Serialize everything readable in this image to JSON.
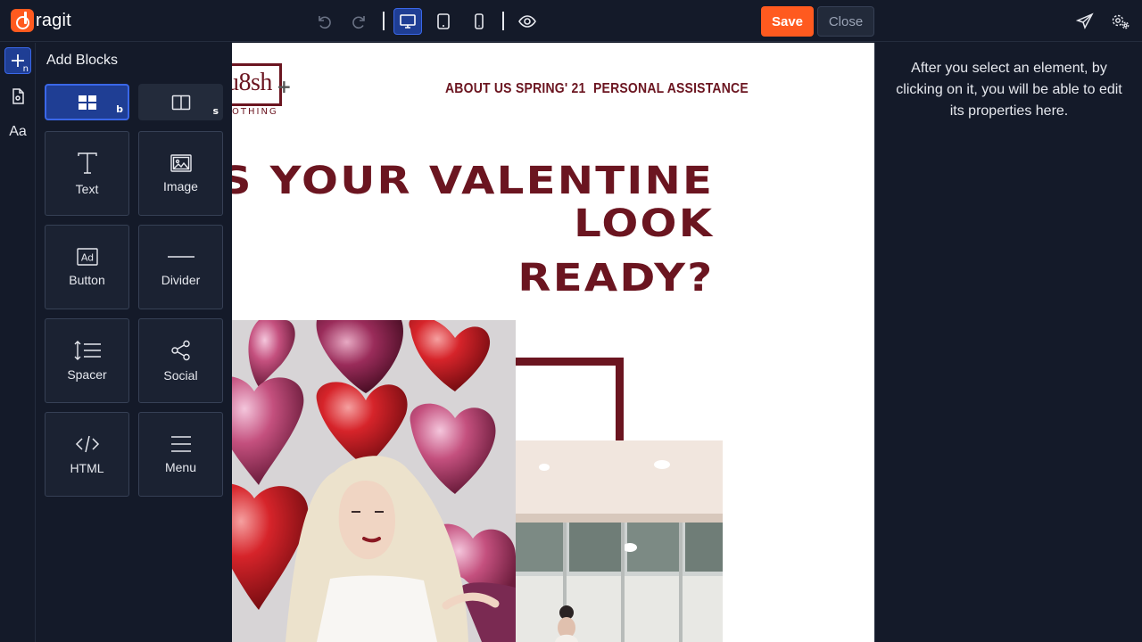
{
  "app": {
    "name": "ragit"
  },
  "toolbar": {
    "save_label": "Save",
    "close_label": "Close",
    "icons": [
      "undo-icon",
      "redo-icon",
      "desktop-icon",
      "tablet-icon",
      "mobile-icon",
      "eye-icon",
      "send-icon",
      "settings-icon"
    ],
    "accent": "#ff5a1f",
    "active": "#1f3e94"
  },
  "rail": {
    "add_key": "n",
    "typography_label": "Aa"
  },
  "panel": {
    "title": "Add Blocks",
    "tabs": [
      {
        "key": "b",
        "icon": "grid-icon"
      },
      {
        "key": "s",
        "icon": "columns-icon"
      }
    ],
    "blocks": [
      {
        "label": "Text",
        "icon": "text-icon"
      },
      {
        "label": "Image",
        "icon": "image-icon"
      },
      {
        "label": "Button",
        "icon": "ad-icon",
        "icon_text": "Ad"
      },
      {
        "label": "Divider",
        "icon": "divider-icon"
      },
      {
        "label": "Spacer",
        "icon": "spacer-icon"
      },
      {
        "label": "Social",
        "icon": "share-icon"
      },
      {
        "label": "HTML",
        "icon": "code-icon"
      },
      {
        "label": "Menu",
        "icon": "menu-icon"
      }
    ]
  },
  "canvas": {
    "brand": {
      "name": "u8sh",
      "sub": "OTHING"
    },
    "nav": [
      "ABOUT US",
      "SPRING' 21",
      "PERSONAL ASSISTANCE"
    ],
    "headline": [
      "S YOUR VALENTINE",
      "LOOK",
      "READY?"
    ],
    "brand_color": "#6b1520"
  },
  "properties": {
    "hint": "After you select an element, by clicking on it, you will be able to edit its properties here."
  }
}
